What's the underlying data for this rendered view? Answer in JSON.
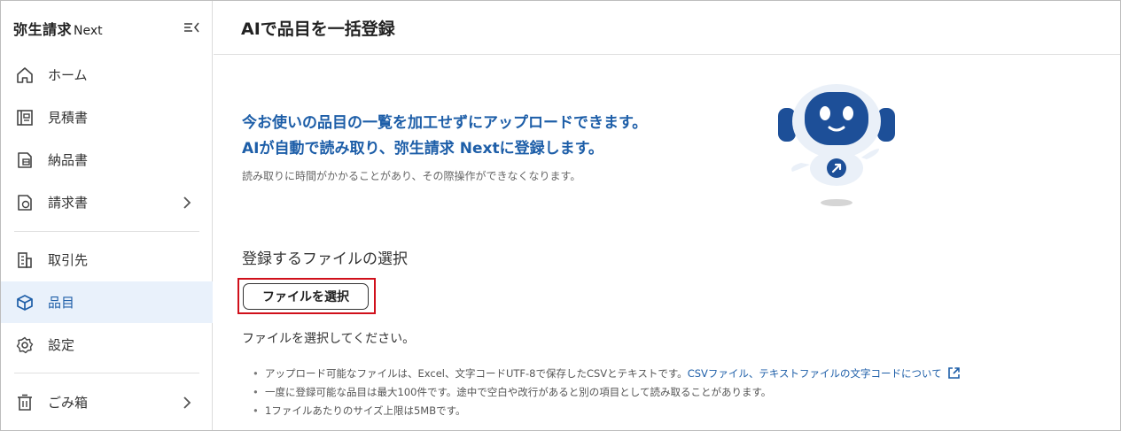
{
  "brand": {
    "main": "弥生請求",
    "sub": "Next"
  },
  "sidebar": {
    "items": [
      {
        "label": "ホーム",
        "icon": "home-icon"
      },
      {
        "label": "見積書",
        "icon": "estimate-icon"
      },
      {
        "label": "納品書",
        "icon": "delivery-note-icon"
      },
      {
        "label": "請求書",
        "icon": "invoice-icon"
      },
      {
        "label": "取引先",
        "icon": "building-icon"
      },
      {
        "label": "品目",
        "icon": "box-icon",
        "active": true
      },
      {
        "label": "設定",
        "icon": "gear-icon"
      },
      {
        "label": "ごみ箱",
        "icon": "trash-icon"
      }
    ]
  },
  "header": {
    "title": "AIで品目を一括登録"
  },
  "main": {
    "headline_line1": "今お使いの品目の一覧を加工せずにアップロードできます。",
    "headline_line2": "AIが自動で読み取り、弥生請求 Nextに登録します。",
    "note": "読み取りに時間がかかることがあり、その際操作ができなくなります。",
    "section_title": "登録するファイルの選択",
    "file_button": "ファイルを選択",
    "hint": "ファイルを選択してください。",
    "bullets": {
      "b1_text": "アップロード可能なファイルは、Excel、文字コードUTF-8で保存したCSVとテキストです。",
      "b1_link": "CSVファイル、テキストファイルの文字コードについて",
      "b2": "一度に登録可能な品目は最大100件です。途中で空白や改行があると別の項目として読み取ることがあります。",
      "b3": "1ファイルあたりのサイズ上限は5MBです。"
    }
  },
  "colors": {
    "accent": "#1d5ea8",
    "active_bg": "#e9f1fb",
    "highlight": "#d0101b",
    "robot_navy": "#1d4f98"
  }
}
